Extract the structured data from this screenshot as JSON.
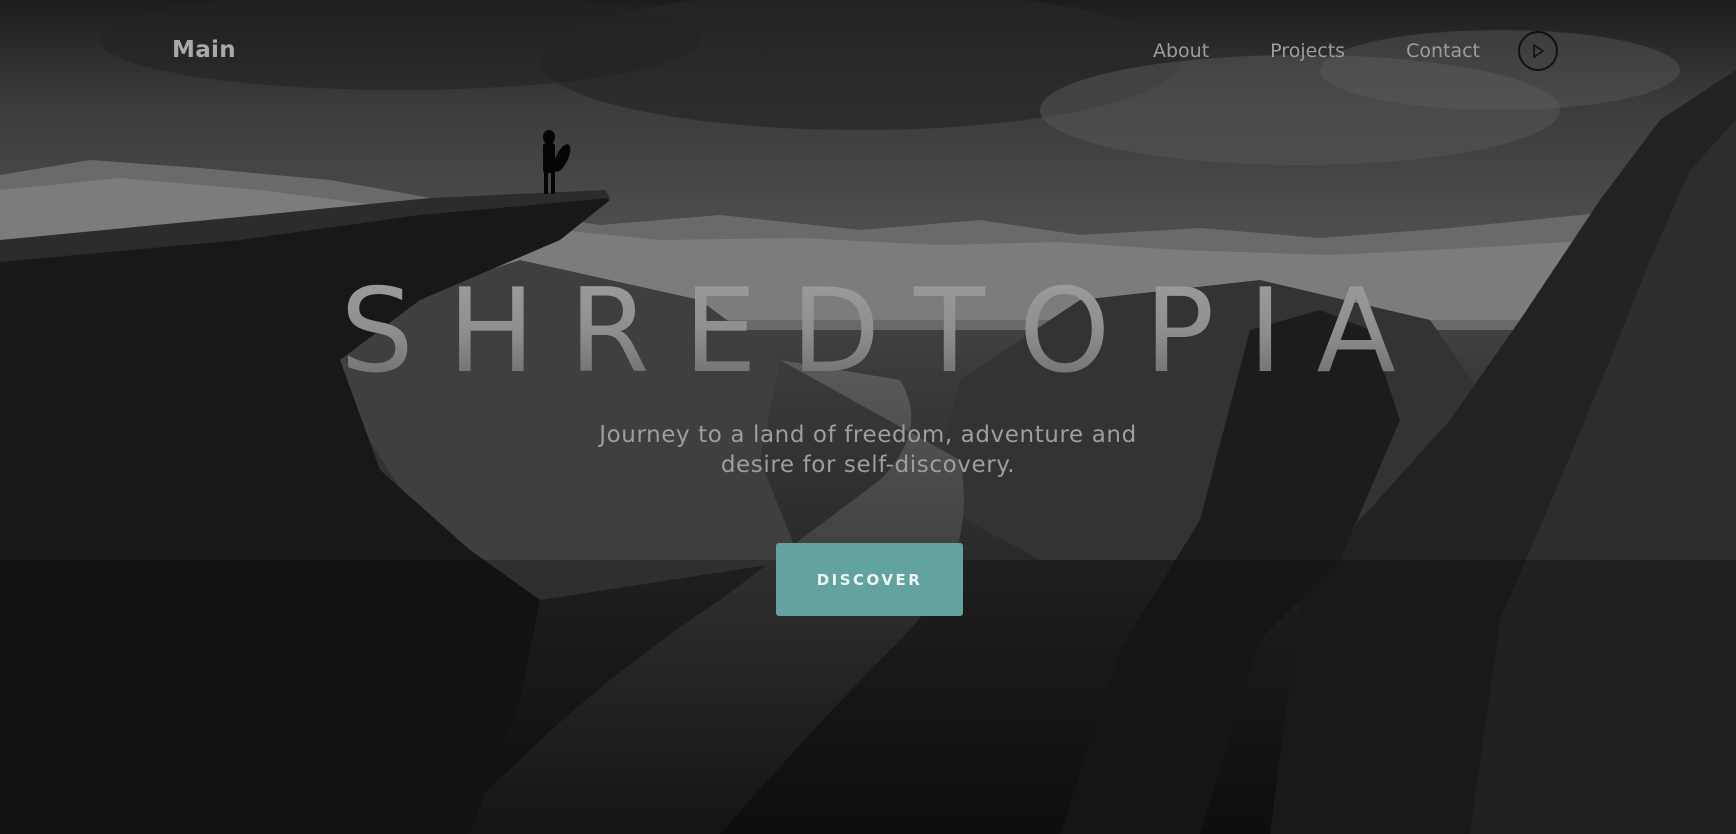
{
  "nav": {
    "brand": "Main",
    "links": [
      "About",
      "Projects",
      "Contact"
    ]
  },
  "hero": {
    "title": "SHREDTOPIA",
    "subtitle": "Journey to a land of freedom, adventure and desire for self-discovery.",
    "cta_label": "DISCOVER"
  },
  "colors": {
    "accent": "#62a39f"
  },
  "icons": {
    "play": "play-icon"
  }
}
